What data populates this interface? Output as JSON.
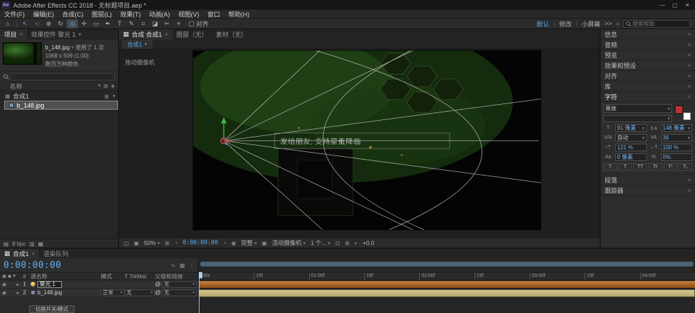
{
  "icons": {
    "grip": "≡",
    "caret": "▾",
    "arrow": "▸",
    "eye": "◉",
    "dot": "●",
    "diamond": "◆",
    "comp": "▦",
    "at": "@",
    "overflow": ">>",
    "bin": "▤",
    "trash": "▥",
    "monitor": "◫",
    "grid": "⊞",
    "snapshot": "◔",
    "channels": "◉",
    "region": "▣",
    "exposure": "◐",
    "views": "⊡",
    "wave": "∿",
    "graph": "▦",
    "more": "⋮",
    "t_size": "T",
    "t_leading": "⇕A",
    "t_kern": "V/A",
    "t_track": "VA",
    "t_vscale": "↕T",
    "t_hscale": "↔T",
    "t_baseline": "Aa",
    "t_prop": "%"
  },
  "titlebar": {
    "app_icon": "Ae",
    "title": "Adobe After Effects CC 2018 - 无标题项目.aep *",
    "min": "—",
    "max": "▢",
    "close": "✕"
  },
  "menu": {
    "items": [
      "文件(F)",
      "编辑(E)",
      "合成(C)",
      "图层(L)",
      "效果(T)",
      "动画(A)",
      "视图(V)",
      "窗口",
      "帮助(H)"
    ]
  },
  "toolbar": {
    "tools": [
      {
        "name": "home",
        "glyph": "⌂"
      },
      {
        "name": "selection",
        "glyph": "↖"
      },
      {
        "name": "hand",
        "glyph": "☜"
      },
      {
        "name": "zoom",
        "glyph": "⊕"
      },
      {
        "name": "rotate",
        "glyph": "↻"
      },
      {
        "name": "unified-camera",
        "glyph": "◎"
      },
      {
        "name": "pan-behind",
        "glyph": "✛"
      },
      {
        "name": "shape",
        "glyph": "▭"
      },
      {
        "name": "pen",
        "glyph": "✒"
      },
      {
        "name": "text",
        "glyph": "T"
      },
      {
        "name": "brush",
        "glyph": "✎"
      },
      {
        "name": "clone-stamp",
        "glyph": "⌗"
      },
      {
        "name": "eraser",
        "glyph": "◪"
      },
      {
        "name": "roto-brush",
        "glyph": "✂"
      },
      {
        "name": "puppet-pin",
        "glyph": "⌖"
      }
    ],
    "snap_label": "对齐",
    "workspaces": [
      "默认",
      "修改",
      "小屏幕"
    ],
    "search_placeholder": "搜索帮助"
  },
  "project": {
    "tab_project": "项目",
    "tab_effect_controls": "效果控件 聚光 1",
    "preview_name": "b_148.jpg",
    "preview_usage": "使用了 1 次",
    "preview_dims": "1068 x 509 (1.00)",
    "preview_colors": "数百万种颜色",
    "name_col": "名称",
    "items": [
      {
        "name": "合成1"
      },
      {
        "name": "b_148.jpg"
      }
    ],
    "bit_depth": "8 bpc"
  },
  "comp": {
    "tab_main": "合成 合成1",
    "tab_layer": "图层（无）",
    "tab_footage": "素材（无）",
    "nav_chip": "合成1",
    "tool_hint": "拖动摄像机",
    "overlay_text": "发给朋友; 支持星位降临",
    "zoom": "50%",
    "timecode": "0:00:00:00",
    "resolution": "完整",
    "camera": "活动摄像机",
    "view_layout": "1 个...",
    "exposure": "+0.0"
  },
  "rightbar": {
    "panels": [
      "信息",
      "音频",
      "预览",
      "效果和预设",
      "对齐",
      "库"
    ],
    "character": {
      "title": "字符",
      "font_family": "黑体",
      "font_style": "",
      "font_size": "91 像素",
      "leading": "148 像素",
      "kerning": "自动",
      "tracking": "36",
      "vertical_scale": "121 %",
      "horizontal_scale": "100 %",
      "baseline_shift": "0 像素",
      "proportional_spacing": "0%",
      "styles": [
        "T",
        "T",
        "TT",
        "Tt",
        "T¹",
        "T₁"
      ]
    },
    "paragraph": "段落",
    "tracker": "跟踪器"
  },
  "timeline": {
    "tab_comp": "合成1",
    "tab_queue": "渲染队列",
    "timecode": "0:00:00:00",
    "columns": {
      "source": "源名称",
      "mode": "模式",
      "trkmat": "T TrkMat",
      "parent": "父级和链接"
    },
    "layers": [
      {
        "num": "1",
        "name": "聚光 1",
        "mode": "",
        "trkmat": "",
        "parent": "无"
      },
      {
        "num": "2",
        "name": "b_148.jpg",
        "mode": "正常",
        "trkmat": "无",
        "parent": "无"
      }
    ],
    "ruler": [
      ":00s",
      "15f",
      "01:00f",
      "15f",
      "02:00f",
      "15f",
      "03:00f",
      "15f",
      "04:00f"
    ],
    "toggle_label": "切换开关/模式"
  }
}
